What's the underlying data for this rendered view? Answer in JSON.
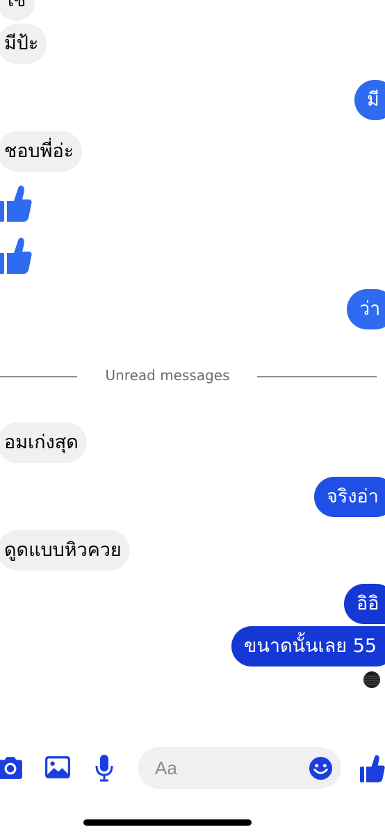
{
  "colors": {
    "outgoing_blue_light": "#2f6bf0",
    "outgoing_blue_dark": "#1537d6",
    "incoming_gray": "#f0f0f3",
    "icon_blue": "#1a3ee0"
  },
  "messages": [
    {
      "direction": "incoming",
      "text": "ใช่"
    },
    {
      "direction": "incoming",
      "text": "มีป้ะ"
    },
    {
      "direction": "outgoing",
      "text": "มี"
    },
    {
      "direction": "incoming",
      "text": "ชอบพี่อ่ะ"
    },
    {
      "direction": "incoming",
      "icon": "thumbs-up-icon"
    },
    {
      "direction": "incoming",
      "icon": "thumbs-up-icon"
    },
    {
      "direction": "outgoing",
      "text": "ว่า"
    },
    {
      "direction": "incoming",
      "text": "อมเก่งสุด"
    },
    {
      "direction": "outgoing",
      "text": "จริงอ่า"
    },
    {
      "direction": "incoming",
      "text": "ดูดแบบหิวควย"
    },
    {
      "direction": "outgoing",
      "text": "อิอิ"
    },
    {
      "direction": "outgoing",
      "text": "ขนาดนั้นเลย 55"
    }
  ],
  "divider": {
    "label": "Unread messages"
  },
  "composer": {
    "placeholder": "Aa",
    "icons": [
      "camera-icon",
      "photo-gallery-icon",
      "microphone-icon",
      "emoji-icon",
      "thumbs-up-icon"
    ]
  }
}
